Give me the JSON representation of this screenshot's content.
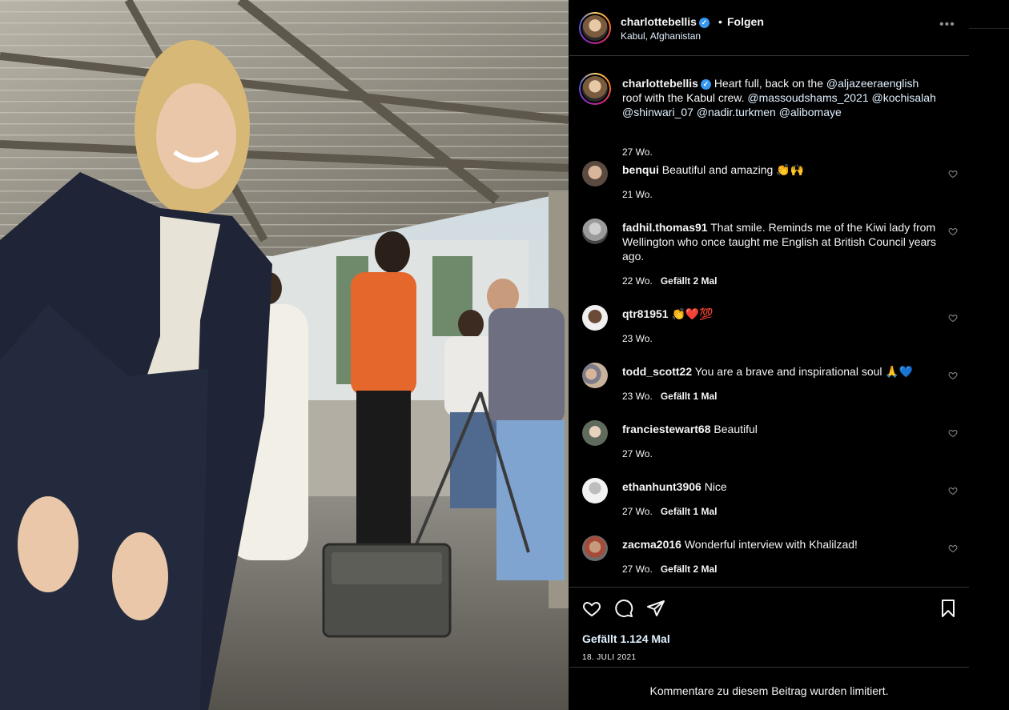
{
  "post": {
    "username": "charlottebellis",
    "follow_label": "Folgen",
    "separator": "•",
    "location": "Kabul, Afghanistan",
    "more_label": "•••"
  },
  "caption": {
    "username": "charlottebellis",
    "text_1": "Heart full, back on the",
    "mention_1": "@aljazeeraenglish",
    "text_2": "roof with the Kabul crew.",
    "mention_2": "@massoudshams_2021",
    "mention_3": "@kochisalah",
    "mention_4": "@shinwari_07",
    "mention_5": "@nadir.turkmen",
    "mention_6": "@alibomaye",
    "time": "27 Wo."
  },
  "comments": [
    {
      "username": "benqui",
      "text": "Beautiful and amazing 👏🙌",
      "time": "21 Wo.",
      "likes": ""
    },
    {
      "username": "fadhil.thomas91",
      "text": "That smile. Reminds me of the Kiwi lady from Wellington who once taught me English at British Council years ago.",
      "time": "22 Wo.",
      "likes": "Gefällt 2 Mal"
    },
    {
      "username": "qtr81951",
      "text": "👏❤️💯",
      "time": "23 Wo.",
      "likes": ""
    },
    {
      "username": "todd_scott22",
      "text": "You are a brave and inspirational soul 🙏💙",
      "time": "23 Wo.",
      "likes": "Gefällt 1 Mal"
    },
    {
      "username": "franciestewart68",
      "text": "Beautiful",
      "time": "27 Wo.",
      "likes": ""
    },
    {
      "username": "ethanhunt3906",
      "text": "Nice",
      "time": "27 Wo.",
      "likes": "Gefällt 1 Mal"
    },
    {
      "username": "zacma2016",
      "text": "Wonderful interview with Khalilzad!",
      "time": "27 Wo.",
      "likes": "Gefällt 2 Mal"
    }
  ],
  "actions": {
    "likes_total": "Gefällt 1.124 Mal",
    "date": "18. JULI 2021"
  },
  "footer": {
    "notice": "Kommentare zu diesem Beitrag wurden limitiert."
  },
  "icons": [
    "heart-icon",
    "comment-icon",
    "share-icon",
    "bookmark-icon",
    "verified-icon",
    "more-icon"
  ],
  "colors": {
    "background": "#000000",
    "text": "#f5f5f5",
    "link": "#e0f1ff",
    "verified": "#3897f0",
    "divider": "#363636"
  }
}
